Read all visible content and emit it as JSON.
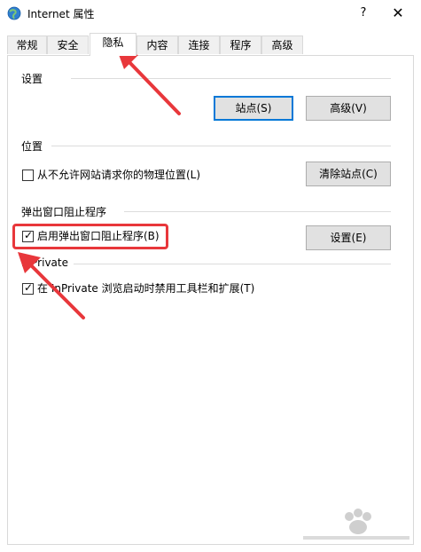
{
  "window": {
    "title": "Internet 属性",
    "help_label": "?",
    "close_label": "✕",
    "icon": "globe-icon"
  },
  "tabs": [
    {
      "label": "常规"
    },
    {
      "label": "安全"
    },
    {
      "label": "隐私",
      "active": true
    },
    {
      "label": "内容"
    },
    {
      "label": "连接"
    },
    {
      "label": "程序"
    },
    {
      "label": "高级"
    }
  ],
  "settings_group": {
    "label": "设置",
    "sites_button": "站点(S)",
    "advanced_button": "高级(V)"
  },
  "location_group": {
    "label": "位置",
    "never_allow_label": "从不允许网站请求你的物理位置(L)",
    "never_allow_checked": false,
    "clear_sites_button": "清除站点(C)"
  },
  "popup_group": {
    "label": "弹出窗口阻止程序",
    "enable_label": "启用弹出窗口阻止程序(B)",
    "enable_checked": true,
    "settings_button": "设置(E)"
  },
  "inprivate_group": {
    "label": "InPrivate",
    "disable_toolbars_label": "在 InPrivate 浏览启动时禁用工具栏和扩展(T)",
    "disable_toolbars_checked": true
  },
  "colors": {
    "highlight_red": "#e8373b",
    "default_button_border": "#0078d7",
    "button_bg": "#e1e1e1"
  }
}
